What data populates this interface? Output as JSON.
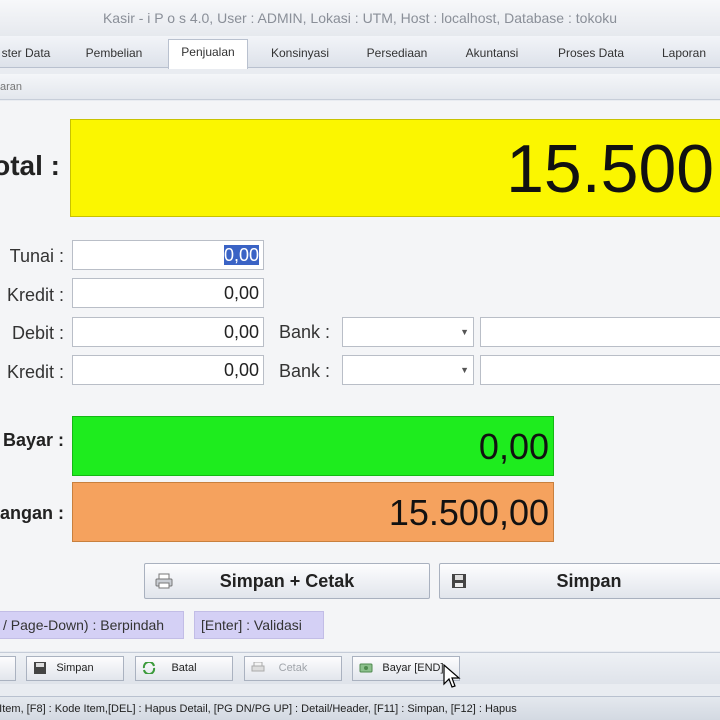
{
  "window": {
    "title": "Kasir - i P o s 4.0, User : ADMIN, Lokasi : UTM, Host : localhost, Database : tokoku"
  },
  "tabs": [
    {
      "label": "ster Data"
    },
    {
      "label": "Pembelian"
    },
    {
      "label": "Penjualan"
    },
    {
      "label": "Konsinyasi"
    },
    {
      "label": "Persediaan"
    },
    {
      "label": "Akuntansi"
    },
    {
      "label": "Proses Data"
    },
    {
      "label": "Laporan"
    }
  ],
  "subtab": {
    "label": "aran"
  },
  "payment": {
    "total_label": "otal :",
    "total_value": "15.500,",
    "tunai_label": "Tunai :",
    "tunai_value": "0,00",
    "kredit_label": "Kredit :",
    "kredit_value": "0,00",
    "debit_label": "Debit :",
    "debit_value": "0,00",
    "kredit2_label": "Kredit :",
    "kredit2_value": "0,00",
    "bank_label": "Bank :",
    "bank2_label": "Bank :",
    "bayar_label": "Bayar :",
    "bayar_value": "0,00",
    "kurang_label": "angan :",
    "kurang_value": "15.500,00"
  },
  "actions": {
    "simpan_cetak": "Simpan + Cetak",
    "simpan": "Simpan"
  },
  "hints": {
    "navigate": "/ Page-Down) : Berpindah",
    "validate": "[Enter] : Validasi"
  },
  "toolbar": {
    "simpan": "Simpan",
    "batal": "Batal",
    "cetak": "Cetak",
    "bayar": "Bayar [END]"
  },
  "statusbar": {
    "text": "h Item, [F8] : Kode Item,[DEL] : Hapus Detail, [PG DN/PG UP] : Detail/Header, [F11] : Simpan, [F12] : Hapus"
  },
  "colors": {
    "total_bg": "#fbf600",
    "bayar_bg": "#1eec1e",
    "kurang_bg": "#f5a25e",
    "hint_bg": "#d4d0f5"
  }
}
